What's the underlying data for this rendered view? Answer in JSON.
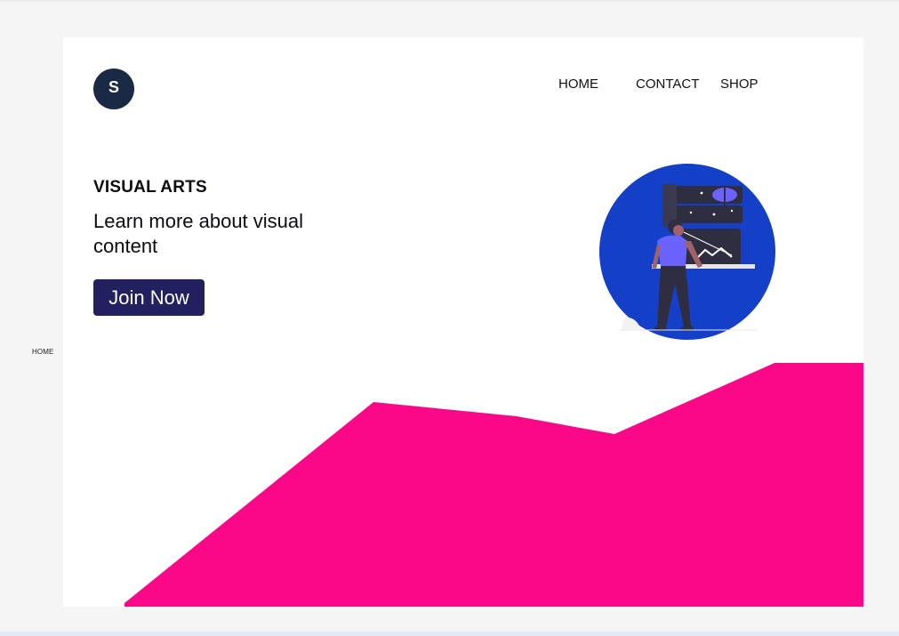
{
  "side_panel": {
    "label": "HOME"
  },
  "logo": {
    "letter": "S",
    "color": "#1b2a44"
  },
  "nav": {
    "items": [
      {
        "label": "HOME"
      },
      {
        "label": "CONTACT"
      },
      {
        "label": "SHOP"
      }
    ]
  },
  "hero": {
    "eyebrow": "VISUAL ARTS",
    "headline": "Learn more about visual content",
    "cta_label": "Join Now",
    "cta_color": "#22205e"
  },
  "illustration": {
    "icon": "person-viewing-artwork-illustration",
    "circle_color": "#1440c8"
  },
  "accent_color": "#fc0788"
}
